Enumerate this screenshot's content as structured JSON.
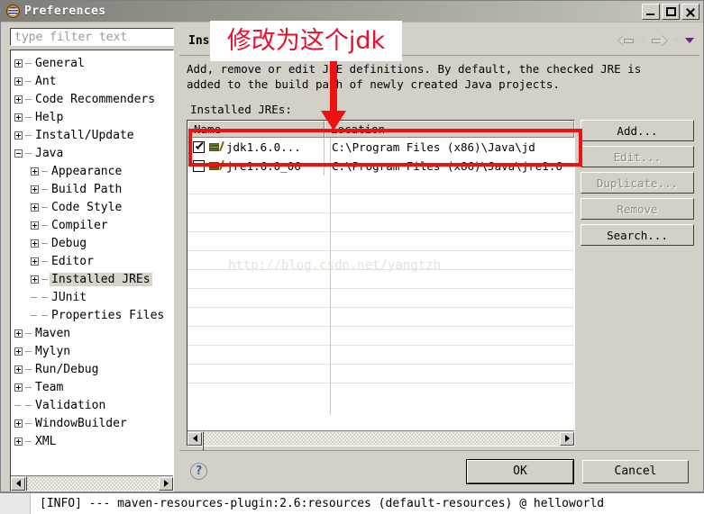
{
  "window": {
    "title": "Preferences",
    "icon": "globe-icon",
    "controls": {
      "minimize": "_",
      "maximize": "□",
      "close": "×"
    }
  },
  "sidebar": {
    "filter": {
      "placeholder": "type filter text",
      "value": ""
    },
    "items": [
      {
        "label": "General",
        "level": 1,
        "expander": "plus",
        "selected": false
      },
      {
        "label": "Ant",
        "level": 1,
        "expander": "plus",
        "selected": false
      },
      {
        "label": "Code Recommenders",
        "level": 1,
        "expander": "plus",
        "selected": false
      },
      {
        "label": "Help",
        "level": 1,
        "expander": "plus",
        "selected": false
      },
      {
        "label": "Install/Update",
        "level": 1,
        "expander": "plus",
        "selected": false
      },
      {
        "label": "Java",
        "level": 1,
        "expander": "minus",
        "selected": false
      },
      {
        "label": "Appearance",
        "level": 2,
        "expander": "plus",
        "selected": false
      },
      {
        "label": "Build Path",
        "level": 2,
        "expander": "plus",
        "selected": false
      },
      {
        "label": "Code Style",
        "level": 2,
        "expander": "plus",
        "selected": false
      },
      {
        "label": "Compiler",
        "level": 2,
        "expander": "plus",
        "selected": false
      },
      {
        "label": "Debug",
        "level": 2,
        "expander": "plus",
        "selected": false
      },
      {
        "label": "Editor",
        "level": 2,
        "expander": "plus",
        "selected": false
      },
      {
        "label": "Installed JREs",
        "level": 2,
        "expander": "plus",
        "selected": true
      },
      {
        "label": "JUnit",
        "level": 2,
        "expander": "none",
        "selected": false
      },
      {
        "label": "Properties Files",
        "level": 2,
        "expander": "none",
        "selected": false
      },
      {
        "label": "Maven",
        "level": 1,
        "expander": "plus",
        "selected": false
      },
      {
        "label": "Mylyn",
        "level": 1,
        "expander": "plus",
        "selected": false
      },
      {
        "label": "Run/Debug",
        "level": 1,
        "expander": "plus",
        "selected": false
      },
      {
        "label": "Team",
        "level": 1,
        "expander": "plus",
        "selected": false
      },
      {
        "label": "Validation",
        "level": 1,
        "expander": "none",
        "selected": false
      },
      {
        "label": "WindowBuilder",
        "level": 1,
        "expander": "plus",
        "selected": false
      },
      {
        "label": "XML",
        "level": 1,
        "expander": "plus",
        "selected": false
      }
    ]
  },
  "page": {
    "title": "Installed JREs",
    "description_line1": "Add, remove or edit JRE definitions. By default, the checked JRE is",
    "description_line2": "added to the build path of newly created Java projects.",
    "list_label": "Installed JREs:",
    "columns": {
      "name": "Name",
      "location": "Location"
    },
    "rows": [
      {
        "checked": true,
        "name": "jdk1.6.0...",
        "location": "C:\\Program Files (x86)\\Java\\jd",
        "icon": "jre-icon"
      },
      {
        "checked": false,
        "name": "jre1.6.0_06",
        "location": "C:\\Program Files (x86)\\Java\\jre1.6",
        "icon": "jre-icon"
      }
    ],
    "buttons": [
      {
        "label": "Add...",
        "enabled": true
      },
      {
        "label": "Edit...",
        "enabled": false
      },
      {
        "label": "Duplicate...",
        "enabled": false
      },
      {
        "label": "Remove",
        "enabled": false
      },
      {
        "label": "Search...",
        "enabled": true
      }
    ]
  },
  "footer": {
    "help": "?",
    "ok": "OK",
    "cancel": "Cancel"
  },
  "annotation": {
    "text": "修改为这个jdk",
    "color": "#e8112d"
  },
  "watermark": "http://blog.csdn.net/yangtzh",
  "console": {
    "line": "[INFO] --- maven-resources-plugin:2.6:resources (default-resources) @ helloworld"
  }
}
